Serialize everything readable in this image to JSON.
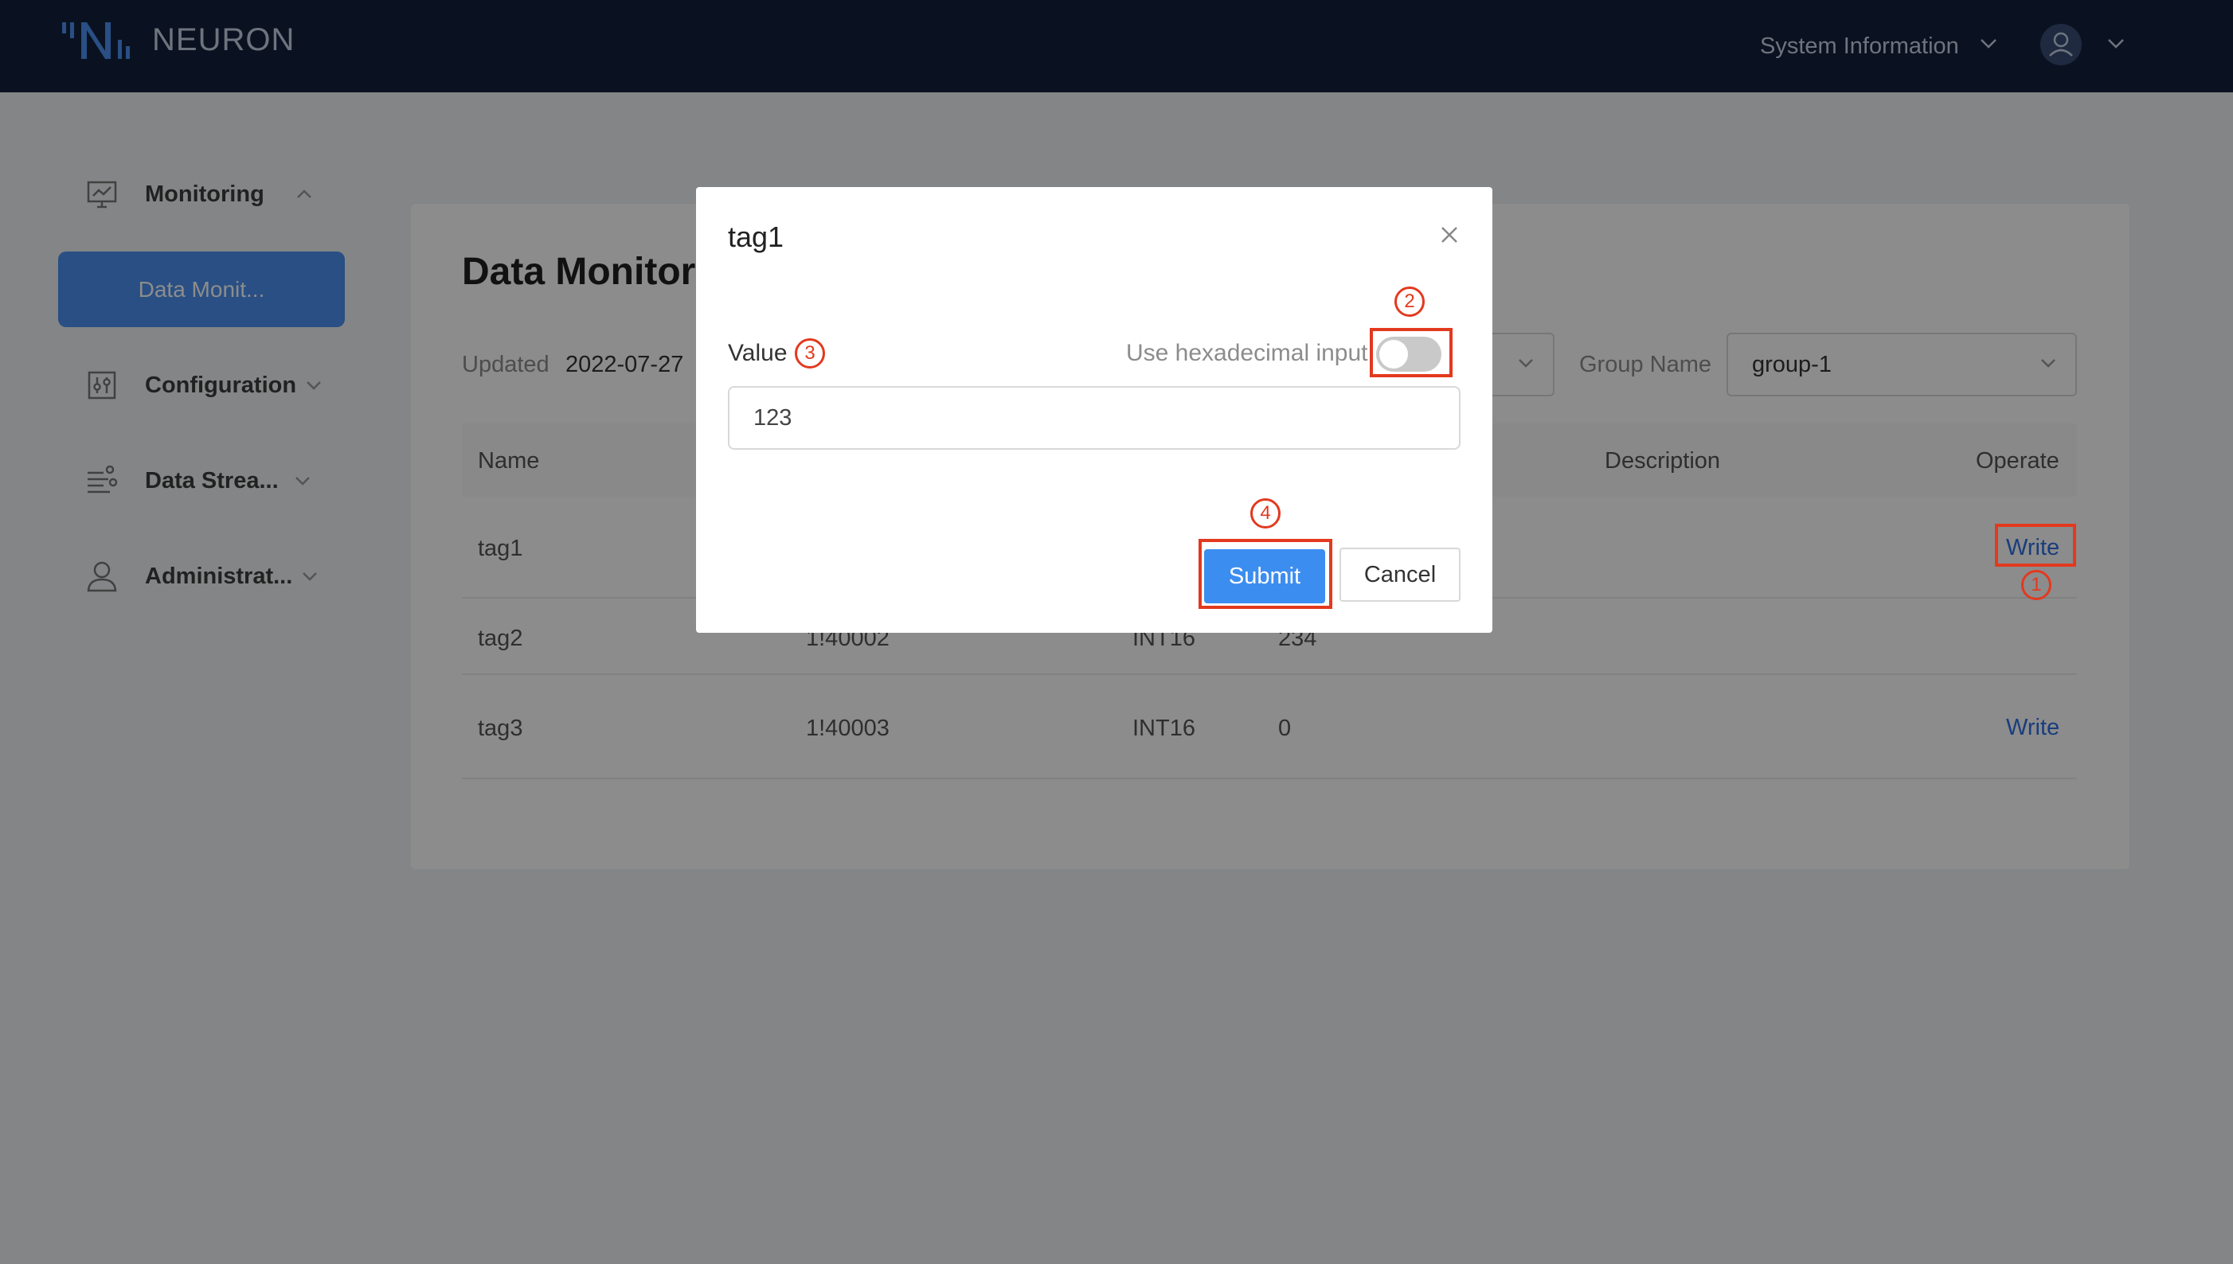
{
  "header": {
    "brand": "NEURON",
    "system_info": "System Information"
  },
  "sidebar": {
    "items": [
      {
        "label": "Monitoring",
        "icon": "monitor-icon"
      },
      {
        "label": "Data Monit...",
        "active": true
      },
      {
        "label": "Configuration",
        "icon": "settings-sliders-icon"
      },
      {
        "label": "Data Strea...",
        "icon": "data-stream-icon"
      },
      {
        "label": "Administrat...",
        "icon": "user-icon"
      }
    ]
  },
  "main": {
    "title": "Data Monitor",
    "updated_label": "Updated",
    "updated_value": "2022-07-27",
    "group_label": "Group Name",
    "group_value": "group-1",
    "table": {
      "headers": {
        "name": "Name",
        "description": "Description",
        "operate": "Operate"
      },
      "rows": [
        {
          "name": "tag1",
          "address": "",
          "type": "",
          "value": "",
          "operate": "Write"
        },
        {
          "name": "tag2",
          "address": "1!40002",
          "type": "INT16",
          "value": "234",
          "operate": ""
        },
        {
          "name": "tag3",
          "address": "1!40003",
          "type": "INT16",
          "value": "0",
          "operate": "Write"
        }
      ]
    }
  },
  "modal": {
    "title": "tag1",
    "value_label": "Value",
    "hex_label": "Use hexadecimal input",
    "hex_enabled": false,
    "value": "123",
    "submit_label": "Submit",
    "cancel_label": "Cancel"
  },
  "annotations": {
    "step1": "1",
    "step2": "2",
    "step3": "3",
    "step4": "4",
    "color": "#e3391e"
  },
  "colors": {
    "header_bg": "#13213c",
    "accent": "#3c8df0",
    "link": "#2f6fe4"
  }
}
